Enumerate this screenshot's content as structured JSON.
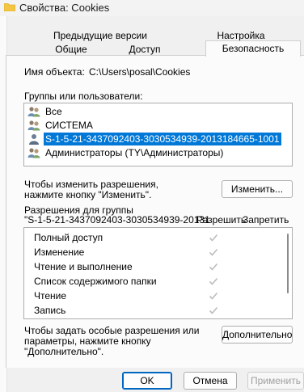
{
  "window": {
    "title": "Свойства: Cookies"
  },
  "tabs_row1": [
    {
      "label": "Предыдущие версии"
    },
    {
      "label": "Настройка"
    }
  ],
  "tabs_row2": [
    {
      "label": "Общие"
    },
    {
      "label": "Доступ"
    },
    {
      "label": "Безопасность",
      "active": true
    }
  ],
  "object": {
    "label": "Имя объекта:",
    "value": "C:\\Users\\posal\\Cookies"
  },
  "groups": {
    "label": "Группы или пользователи:",
    "items": [
      {
        "name": "Все",
        "icon": "users-group-icon"
      },
      {
        "name": "СИСТЕМА",
        "icon": "users-group-icon"
      },
      {
        "name": "S-1-5-21-3437092403-3030534939-2013184665-1001",
        "icon": "user-icon",
        "selected": true
      },
      {
        "name": "Администраторы (TY\\Администраторы)",
        "icon": "users-group-icon"
      }
    ]
  },
  "change": {
    "hint_line1": "Чтобы изменить разрешения,",
    "hint_line2": "нажмите кнопку \"Изменить\".",
    "button": "Изменить..."
  },
  "permissions": {
    "header_line1": "Разрешения для группы",
    "header_line2": "\"S-1-5-21-3437092403-3030534939-20131",
    "allow_label": "Разрешить",
    "deny_label": "Запретить",
    "rows": [
      {
        "name": "Полный доступ",
        "allow": true
      },
      {
        "name": "Изменение",
        "allow": true
      },
      {
        "name": "Чтение и выполнение",
        "allow": true
      },
      {
        "name": "Список содержимого папки",
        "allow": true
      },
      {
        "name": "Чтение",
        "allow": true
      },
      {
        "name": "Запись",
        "allow": true
      }
    ]
  },
  "advanced": {
    "hint_line1": "Чтобы задать особые разрешения или",
    "hint_line2": "параметры, нажмите кнопку",
    "hint_line3": "\"Дополнительно\".",
    "button": "Дополнительно"
  },
  "footer": {
    "ok": "OK",
    "cancel": "Отмена",
    "apply": "Применить"
  },
  "colors": {
    "selection": "#0078d7",
    "check": "#bcbcbc",
    "folder": "#f4c542"
  }
}
